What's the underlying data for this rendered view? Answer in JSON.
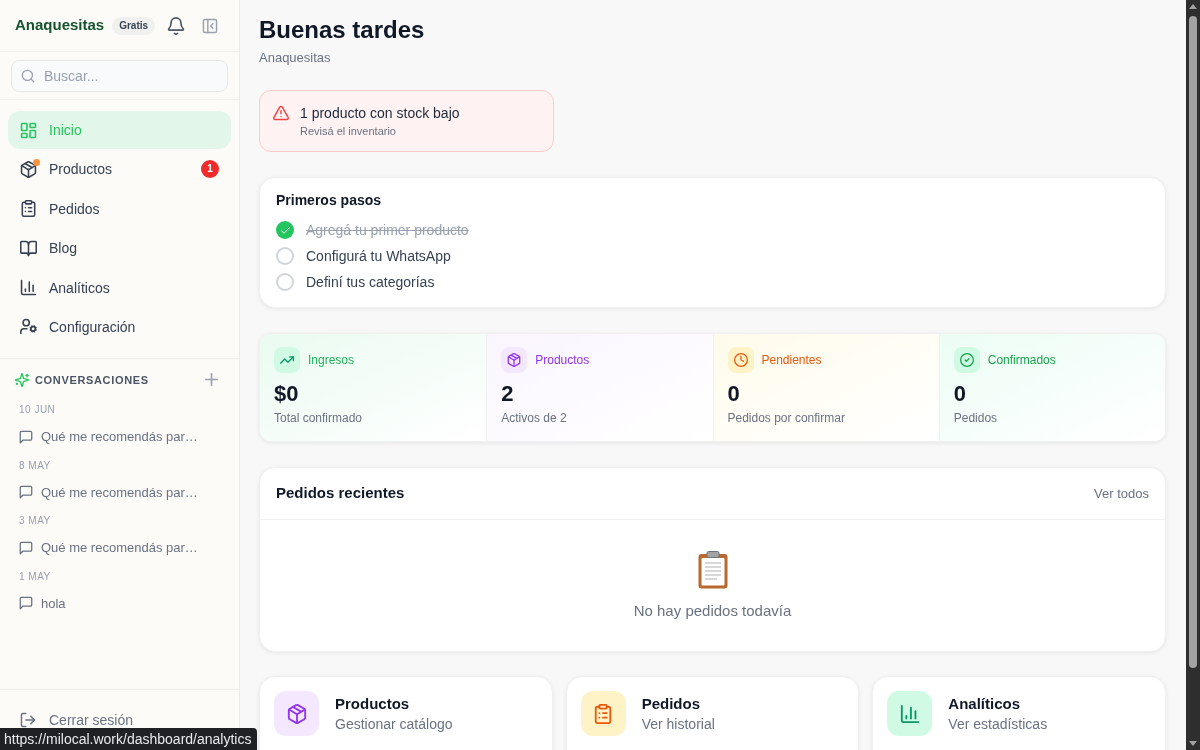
{
  "sidebar": {
    "brand": "Anaquesitas",
    "plan_badge": "Gratis",
    "search": {
      "placeholder": "Buscar..."
    },
    "nav_items": [
      {
        "kind": "home",
        "label": "Inicio",
        "selected": true,
        "alert_dot": false
      },
      {
        "kind": "products",
        "label": "Productos",
        "selected": false,
        "alert_dot": true,
        "badge": "1"
      },
      {
        "kind": "orders",
        "label": "Pedidos",
        "selected": false,
        "alert_dot": false
      },
      {
        "kind": "blog",
        "label": "Blog",
        "selected": false,
        "alert_dot": false
      },
      {
        "kind": "analytics",
        "label": "Analíticos",
        "selected": false,
        "alert_dot": false
      },
      {
        "kind": "settings",
        "label": "Configuración",
        "selected": false,
        "alert_dot": false
      }
    ],
    "conversations": {
      "title": "CONVERSACIONES",
      "groups": [
        {
          "date": "10 JUN",
          "items": [
            "Qué me recomendás par…"
          ]
        },
        {
          "date": "8 MAY",
          "items": [
            "Qué me recomendás par…"
          ]
        },
        {
          "date": "3 MAY",
          "items": [
            "Qué me recomendás par…"
          ]
        },
        {
          "date": "1 MAY",
          "items": [
            "hola"
          ]
        }
      ]
    },
    "logout": "Cerrar sesión"
  },
  "main": {
    "greeting": "Buenas tardes",
    "subtitle": "Anaquesitas",
    "alert": {
      "title": "1 producto con stock bajo",
      "subtitle": "Revisá el inventario"
    },
    "onboarding": {
      "title": "Primeros pasos",
      "steps": [
        {
          "label": "Agregá tu primer producto",
          "checked": true
        },
        {
          "label": "Configurá tu WhatsApp",
          "checked": false
        },
        {
          "label": "Definí tus categorías",
          "checked": false
        }
      ]
    },
    "stats": [
      {
        "kind": "revenue",
        "label": "Ingresos",
        "value": "$0",
        "caption": "Total confirmado"
      },
      {
        "kind": "products",
        "label": "Productos",
        "value": "2",
        "caption": "Activos de 2"
      },
      {
        "kind": "pending",
        "label": "Pendientes",
        "value": "0",
        "caption": "Pedidos por confirmar"
      },
      {
        "kind": "confirmed",
        "label": "Confirmados",
        "value": "0",
        "caption": "Pedidos"
      }
    ],
    "recent_orders": {
      "title": "Pedidos recientes",
      "link": "Ver todos",
      "empty_text": "No hay pedidos todavía"
    },
    "quick_links": [
      {
        "kind": "products",
        "title": "Productos",
        "subtitle": "Gestionar catálogo"
      },
      {
        "kind": "orders",
        "title": "Pedidos",
        "subtitle": "Ver historial"
      },
      {
        "kind": "analytics",
        "title": "Analíticos",
        "subtitle": "Ver estadísticas"
      }
    ]
  },
  "link_preview": "https://milocal.work/dashboard/analytics"
}
